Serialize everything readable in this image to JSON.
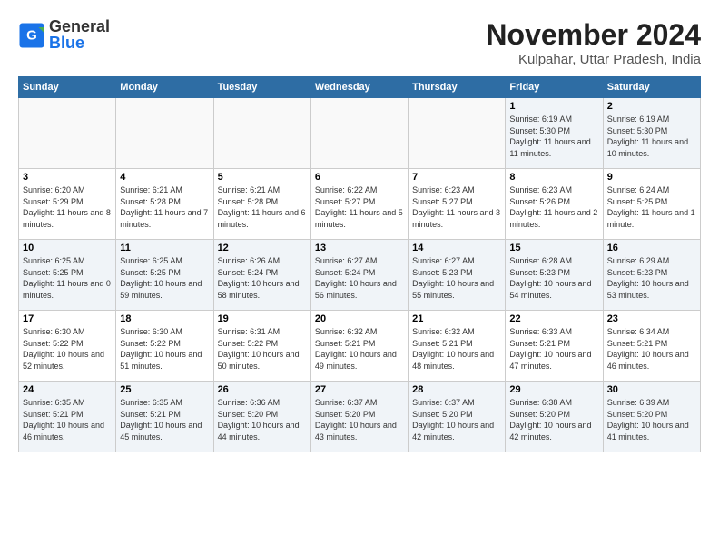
{
  "header": {
    "logo_line1": "General",
    "logo_line2": "Blue",
    "month_title": "November 2024",
    "subtitle": "Kulpahar, Uttar Pradesh, India"
  },
  "weekdays": [
    "Sunday",
    "Monday",
    "Tuesday",
    "Wednesday",
    "Thursday",
    "Friday",
    "Saturday"
  ],
  "weeks": [
    [
      {
        "day": "",
        "info": "",
        "empty": true
      },
      {
        "day": "",
        "info": "",
        "empty": true
      },
      {
        "day": "",
        "info": "",
        "empty": true
      },
      {
        "day": "",
        "info": "",
        "empty": true
      },
      {
        "day": "",
        "info": "",
        "empty": true
      },
      {
        "day": "1",
        "info": "Sunrise: 6:19 AM\nSunset: 5:30 PM\nDaylight: 11 hours and 11 minutes."
      },
      {
        "day": "2",
        "info": "Sunrise: 6:19 AM\nSunset: 5:30 PM\nDaylight: 11 hours and 10 minutes."
      }
    ],
    [
      {
        "day": "3",
        "info": "Sunrise: 6:20 AM\nSunset: 5:29 PM\nDaylight: 11 hours and 8 minutes."
      },
      {
        "day": "4",
        "info": "Sunrise: 6:21 AM\nSunset: 5:28 PM\nDaylight: 11 hours and 7 minutes."
      },
      {
        "day": "5",
        "info": "Sunrise: 6:21 AM\nSunset: 5:28 PM\nDaylight: 11 hours and 6 minutes."
      },
      {
        "day": "6",
        "info": "Sunrise: 6:22 AM\nSunset: 5:27 PM\nDaylight: 11 hours and 5 minutes."
      },
      {
        "day": "7",
        "info": "Sunrise: 6:23 AM\nSunset: 5:27 PM\nDaylight: 11 hours and 3 minutes."
      },
      {
        "day": "8",
        "info": "Sunrise: 6:23 AM\nSunset: 5:26 PM\nDaylight: 11 hours and 2 minutes."
      },
      {
        "day": "9",
        "info": "Sunrise: 6:24 AM\nSunset: 5:25 PM\nDaylight: 11 hours and 1 minute."
      }
    ],
    [
      {
        "day": "10",
        "info": "Sunrise: 6:25 AM\nSunset: 5:25 PM\nDaylight: 11 hours and 0 minutes."
      },
      {
        "day": "11",
        "info": "Sunrise: 6:25 AM\nSunset: 5:25 PM\nDaylight: 10 hours and 59 minutes."
      },
      {
        "day": "12",
        "info": "Sunrise: 6:26 AM\nSunset: 5:24 PM\nDaylight: 10 hours and 58 minutes."
      },
      {
        "day": "13",
        "info": "Sunrise: 6:27 AM\nSunset: 5:24 PM\nDaylight: 10 hours and 56 minutes."
      },
      {
        "day": "14",
        "info": "Sunrise: 6:27 AM\nSunset: 5:23 PM\nDaylight: 10 hours and 55 minutes."
      },
      {
        "day": "15",
        "info": "Sunrise: 6:28 AM\nSunset: 5:23 PM\nDaylight: 10 hours and 54 minutes."
      },
      {
        "day": "16",
        "info": "Sunrise: 6:29 AM\nSunset: 5:23 PM\nDaylight: 10 hours and 53 minutes."
      }
    ],
    [
      {
        "day": "17",
        "info": "Sunrise: 6:30 AM\nSunset: 5:22 PM\nDaylight: 10 hours and 52 minutes."
      },
      {
        "day": "18",
        "info": "Sunrise: 6:30 AM\nSunset: 5:22 PM\nDaylight: 10 hours and 51 minutes."
      },
      {
        "day": "19",
        "info": "Sunrise: 6:31 AM\nSunset: 5:22 PM\nDaylight: 10 hours and 50 minutes."
      },
      {
        "day": "20",
        "info": "Sunrise: 6:32 AM\nSunset: 5:21 PM\nDaylight: 10 hours and 49 minutes."
      },
      {
        "day": "21",
        "info": "Sunrise: 6:32 AM\nSunset: 5:21 PM\nDaylight: 10 hours and 48 minutes."
      },
      {
        "day": "22",
        "info": "Sunrise: 6:33 AM\nSunset: 5:21 PM\nDaylight: 10 hours and 47 minutes."
      },
      {
        "day": "23",
        "info": "Sunrise: 6:34 AM\nSunset: 5:21 PM\nDaylight: 10 hours and 46 minutes."
      }
    ],
    [
      {
        "day": "24",
        "info": "Sunrise: 6:35 AM\nSunset: 5:21 PM\nDaylight: 10 hours and 46 minutes."
      },
      {
        "day": "25",
        "info": "Sunrise: 6:35 AM\nSunset: 5:21 PM\nDaylight: 10 hours and 45 minutes."
      },
      {
        "day": "26",
        "info": "Sunrise: 6:36 AM\nSunset: 5:20 PM\nDaylight: 10 hours and 44 minutes."
      },
      {
        "day": "27",
        "info": "Sunrise: 6:37 AM\nSunset: 5:20 PM\nDaylight: 10 hours and 43 minutes."
      },
      {
        "day": "28",
        "info": "Sunrise: 6:37 AM\nSunset: 5:20 PM\nDaylight: 10 hours and 42 minutes."
      },
      {
        "day": "29",
        "info": "Sunrise: 6:38 AM\nSunset: 5:20 PM\nDaylight: 10 hours and 42 minutes."
      },
      {
        "day": "30",
        "info": "Sunrise: 6:39 AM\nSunset: 5:20 PM\nDaylight: 10 hours and 41 minutes."
      }
    ]
  ]
}
